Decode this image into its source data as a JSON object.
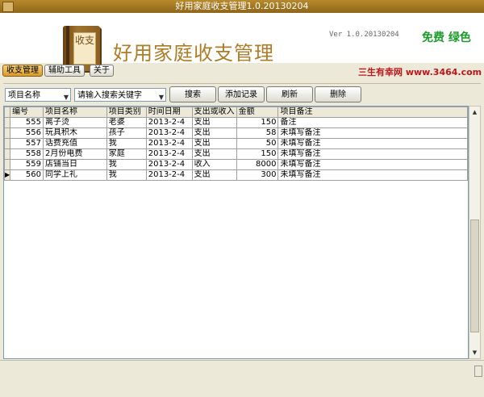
{
  "window": {
    "title": "好用家庭收支管理1.0.20130204"
  },
  "banner": {
    "logo_text": "收支",
    "app_title": "好用家庭收支管理",
    "version": "Ver 1.0.20130204",
    "free": "免费 绿色",
    "website": "三生有幸网 www.3464.com"
  },
  "menu": {
    "items": [
      {
        "label": "收支管理"
      },
      {
        "label": "辅助工具"
      },
      {
        "label": "关于"
      }
    ]
  },
  "toolbar": {
    "field_select": "项目名称",
    "keyword_select": "请输入搜索关键字",
    "search": "搜索",
    "add": "添加记录",
    "refresh": "刷新",
    "delete": "删除"
  },
  "table": {
    "headers": [
      "编号",
      "项目名称",
      "项目类别",
      "时间日期",
      "支出或收入",
      "金额",
      "项目备注"
    ],
    "rows": [
      [
        "555",
        "离子烫",
        "老婆",
        "2013-2-4",
        "支出",
        "150",
        "备注"
      ],
      [
        "556",
        "玩具积木",
        "孩子",
        "2013-2-4",
        "支出",
        "58",
        "未填写备注"
      ],
      [
        "557",
        "话费充值",
        "我",
        "2013-2-4",
        "支出",
        "50",
        "未填写备注"
      ],
      [
        "558",
        "2月份电费",
        "家庭",
        "2013-2-4",
        "支出",
        "150",
        "未填写备注"
      ],
      [
        "559",
        "店铺当日",
        "我",
        "2013-2-4",
        "收入",
        "8000",
        "未填写备注"
      ],
      [
        "560",
        "同学上礼",
        "我",
        "2013-2-4",
        "支出",
        "300",
        "未填写备注"
      ]
    ],
    "current_row_index": 5
  }
}
